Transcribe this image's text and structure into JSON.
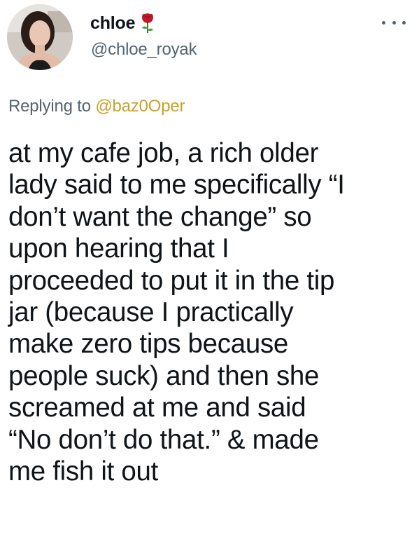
{
  "author": {
    "display_name": "chloe",
    "handle": "@chloe_royak",
    "avatar_icon": "profile-photo",
    "name_emoji_icon": "rose-icon"
  },
  "reply": {
    "prefix": "Replying to ",
    "mention": "@baz0Oper"
  },
  "tweet": {
    "lines": [
      "at my cafe job, a rich older",
      "lady said to me specifically “I",
      "don’t want the change” so",
      "upon hearing that I",
      "proceeded to put it in the tip",
      "jar (because I practically",
      "make zero tips because",
      "people suck) and then she",
      "screamed at me and said",
      "“No don’t do that.” & made",
      "me fish it out"
    ]
  },
  "colors": {
    "text": "#0f1419",
    "secondary": "#536471",
    "mention": "#c9a227",
    "rose": "#c0182b"
  },
  "menu": {
    "more_icon": "more-options-icon"
  }
}
